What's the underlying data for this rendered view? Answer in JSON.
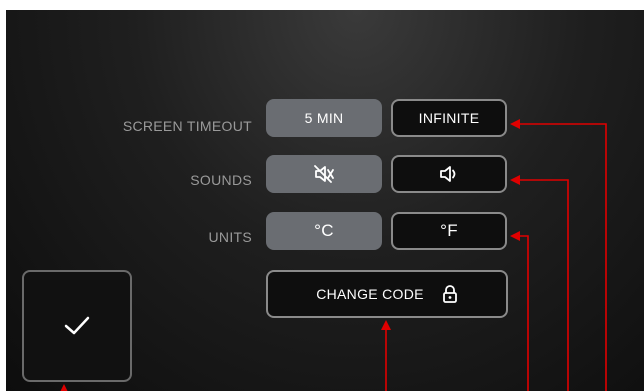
{
  "settings": {
    "screen_timeout": {
      "label": "SCREEN TIMEOUT",
      "options": [
        "5 MIN",
        "INFINITE"
      ],
      "selected": "5 MIN"
    },
    "sounds": {
      "label": "SOUNDS",
      "options": [
        "mute-icon",
        "speaker-icon"
      ],
      "selected": "mute-icon"
    },
    "units": {
      "label": "UNITS",
      "options": [
        "°C",
        "°F"
      ],
      "selected": "°C"
    },
    "change_code": {
      "label": "CHANGE CODE",
      "icon": "lock-icon"
    }
  },
  "confirm": {
    "icon": "checkmark-icon"
  },
  "colors": {
    "active_button": "#6a6d72",
    "outline_border": "#8a8a8a",
    "annotation_red": "#e00000"
  }
}
